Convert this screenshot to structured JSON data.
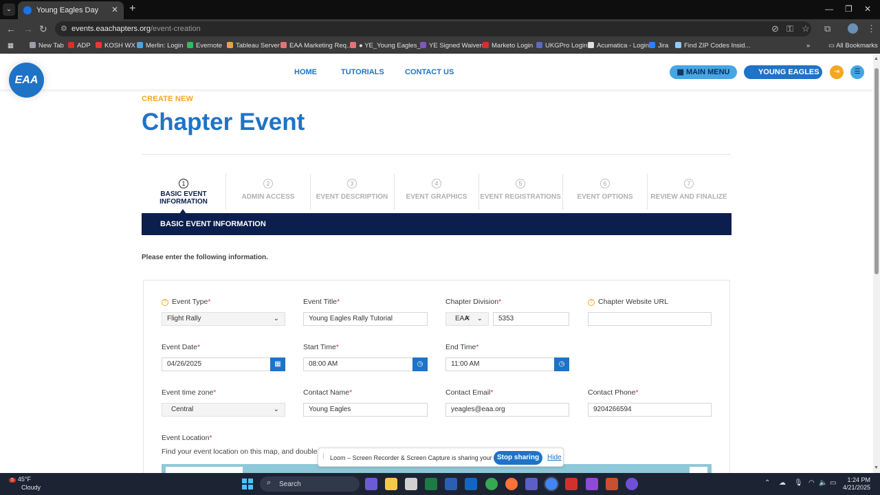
{
  "browser": {
    "tab_title": "Young Eagles Day",
    "url_host": "events.eaachapters.org",
    "url_path": "/event-creation",
    "bookmarks": [
      {
        "label": "New Tab",
        "color": "#9aa0a6"
      },
      {
        "label": "ADP",
        "color": "#d93025"
      },
      {
        "label": "KOSH WX",
        "color": "#e53935"
      },
      {
        "label": "Merlin: Login",
        "color": "#4fa3e0"
      },
      {
        "label": "Evernote",
        "color": "#2dbe60"
      },
      {
        "label": "Tableau Server",
        "color": "#e8a33d"
      },
      {
        "label": "EAA Marketing Req...",
        "color": "#e57373"
      },
      {
        "label": "● YE_Young Eagles_...",
        "color": "#e57373"
      },
      {
        "label": "YE Signed Waivers",
        "color": "#7e57c2"
      },
      {
        "label": "Marketo Login",
        "color": "#d32f2f"
      },
      {
        "label": "UKGPro Login",
        "color": "#5c6bc0"
      },
      {
        "label": "Acumatica - Login",
        "color": "#e0e0e0"
      },
      {
        "label": "Jira",
        "color": "#2684ff"
      },
      {
        "label": "Find ZIP Codes Insid...",
        "color": "#90caf9"
      }
    ],
    "all_bookmarks": "All Bookmarks"
  },
  "site": {
    "logo": "EAA",
    "nav": {
      "home": "HOME",
      "tutorials": "TUTORIALS",
      "contact": "CONTACT US"
    },
    "main_menu": "MAIN MENU",
    "young_eagles": "YOUNG EAGLES"
  },
  "page": {
    "eyebrow": "CREATE NEW",
    "title": "Chapter Event",
    "steps": [
      {
        "num": "1",
        "label": "BASIC EVENT INFORMATION"
      },
      {
        "num": "2",
        "label": "ADMIN ACCESS"
      },
      {
        "num": "3",
        "label": "EVENT DESCRIPTION"
      },
      {
        "num": "4",
        "label": "EVENT GRAPHICS"
      },
      {
        "num": "5",
        "label": "EVENT REGISTRATIONS"
      },
      {
        "num": "6",
        "label": "EVENT OPTIONS"
      },
      {
        "num": "7",
        "label": "REVIEW AND FINALIZE"
      }
    ],
    "section_title": "BASIC EVENT INFORMATION",
    "intro": "Please enter the following information."
  },
  "form": {
    "event_type": {
      "label": "Event Type",
      "value": "Flight Rally"
    },
    "event_title": {
      "label": "Event Title",
      "value": "Young Eagles Rally Tutorial"
    },
    "chapter_division": {
      "label": "Chapter Division",
      "prefix": "EAA",
      "value": "5353"
    },
    "chapter_website": {
      "label": "Chapter Website URL",
      "value": ""
    },
    "event_date": {
      "label": "Event Date",
      "value": "04/26/2025"
    },
    "start_time": {
      "label": "Start Time",
      "value": "08:00 AM"
    },
    "end_time": {
      "label": "End Time",
      "value": "11:00 AM"
    },
    "time_zone": {
      "label": "Event time zone",
      "value": "Central"
    },
    "contact_name": {
      "label": "Contact Name",
      "value": "Young Eagles"
    },
    "contact_email": {
      "label": "Contact Email",
      "value": "yeagles@eaa.org"
    },
    "contact_phone": {
      "label": "Contact Phone",
      "value": "9204266594"
    },
    "location": {
      "label": "Event Location",
      "help": "Find your event location on this map, and double cl"
    }
  },
  "loom": {
    "message": "Loom – Screen Recorder & Screen Capture is sharing your screen.",
    "stop": "Stop sharing",
    "hide": "Hide"
  },
  "taskbar": {
    "temp": "45°F",
    "condition": "Cloudy",
    "badge": "5",
    "search": "Search",
    "time": "1:24 PM",
    "date": "4/21/2025"
  }
}
